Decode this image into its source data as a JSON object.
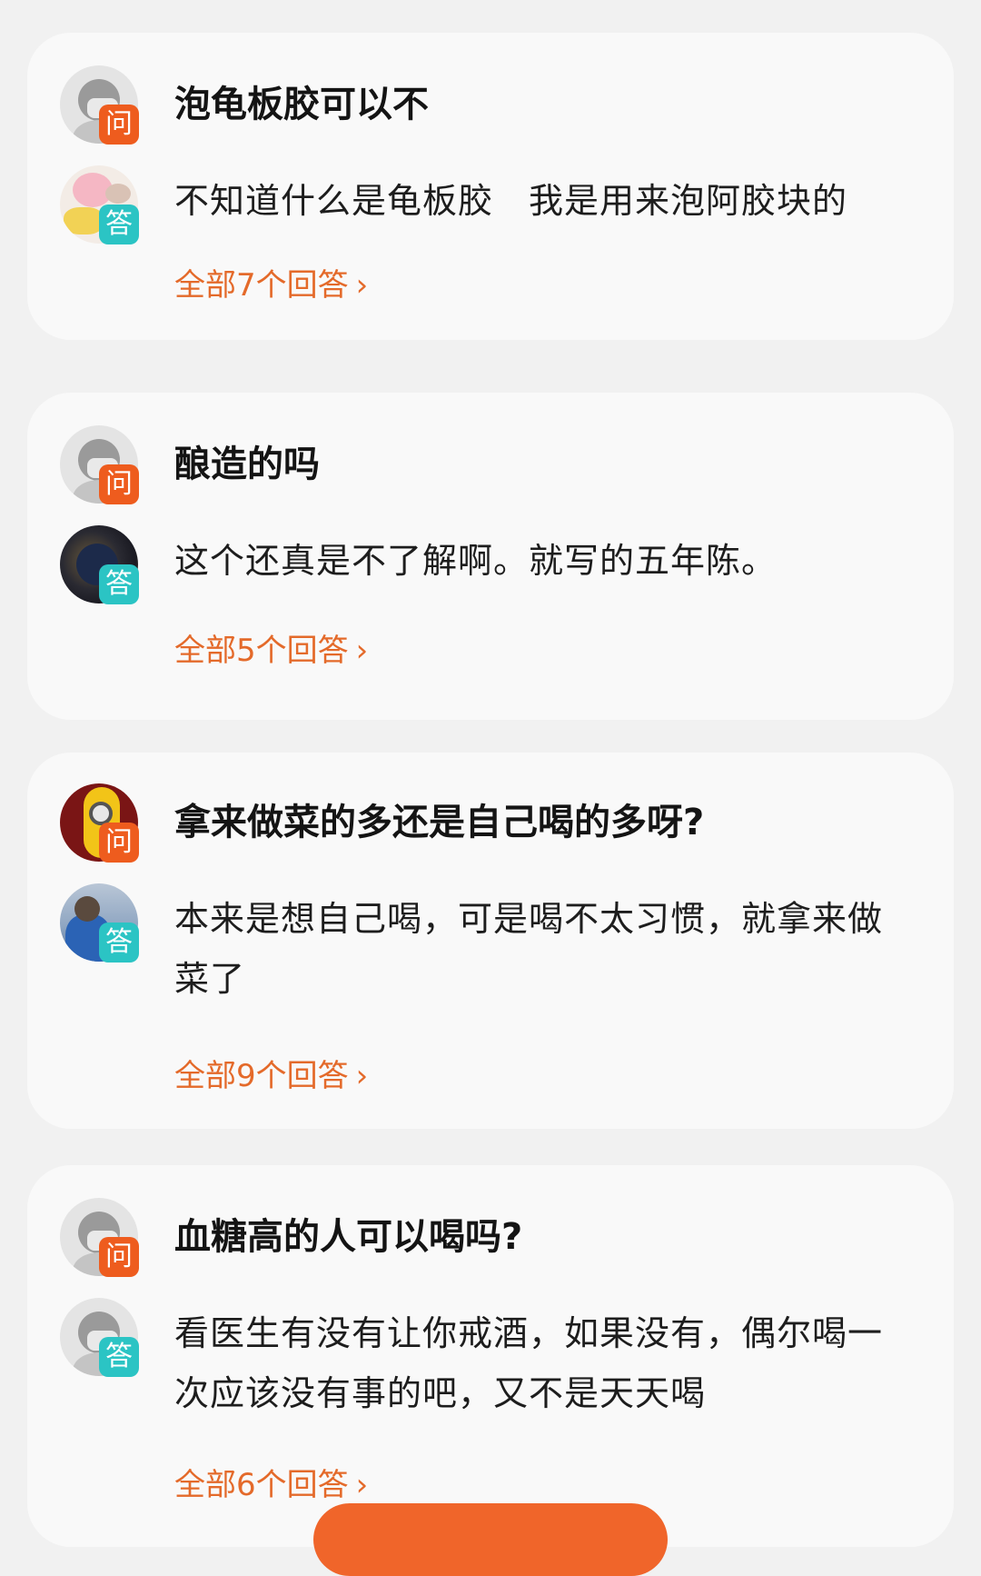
{
  "qa_list": [
    {
      "question": "泡龟板胶可以不",
      "answer": "不知道什么是龟板胶　我是用来泡阿胶块的",
      "more_label": "全部7个回答",
      "asker_avatar": "default-avatar",
      "answerer_avatar": "pig-avatar"
    },
    {
      "question": "酿造的吗",
      "answer": "这个还真是不了解啊。就写的五年陈。",
      "more_label": "全部5个回答",
      "asker_avatar": "default-avatar",
      "answerer_avatar": "photo-avatar"
    },
    {
      "question": "拿来做菜的多还是自己喝的多呀?",
      "answer": "本来是想自己喝，可是喝不太习惯，就拿来做菜了",
      "more_label": "全部9个回答",
      "asker_avatar": "minion-avatar",
      "answerer_avatar": "photo-avatar"
    },
    {
      "question": "血糖高的人可以喝吗?",
      "answer": "看医生有没有让你戒酒，如果没有，偶尔喝一次应该没有事的吧，又不是天天喝",
      "more_label": "全部6个回答",
      "asker_avatar": "default-avatar",
      "answerer_avatar": "default-avatar"
    }
  ],
  "badges": {
    "question": "问",
    "answer": "答"
  },
  "colors": {
    "accent": "#e46a2a",
    "question_badge": "#ee5c1e",
    "answer_badge": "#2bc4c4",
    "card_bg": "#f9f9f9",
    "page_bg": "#f1f1f1"
  },
  "icons": {
    "more_chevron": "›"
  }
}
